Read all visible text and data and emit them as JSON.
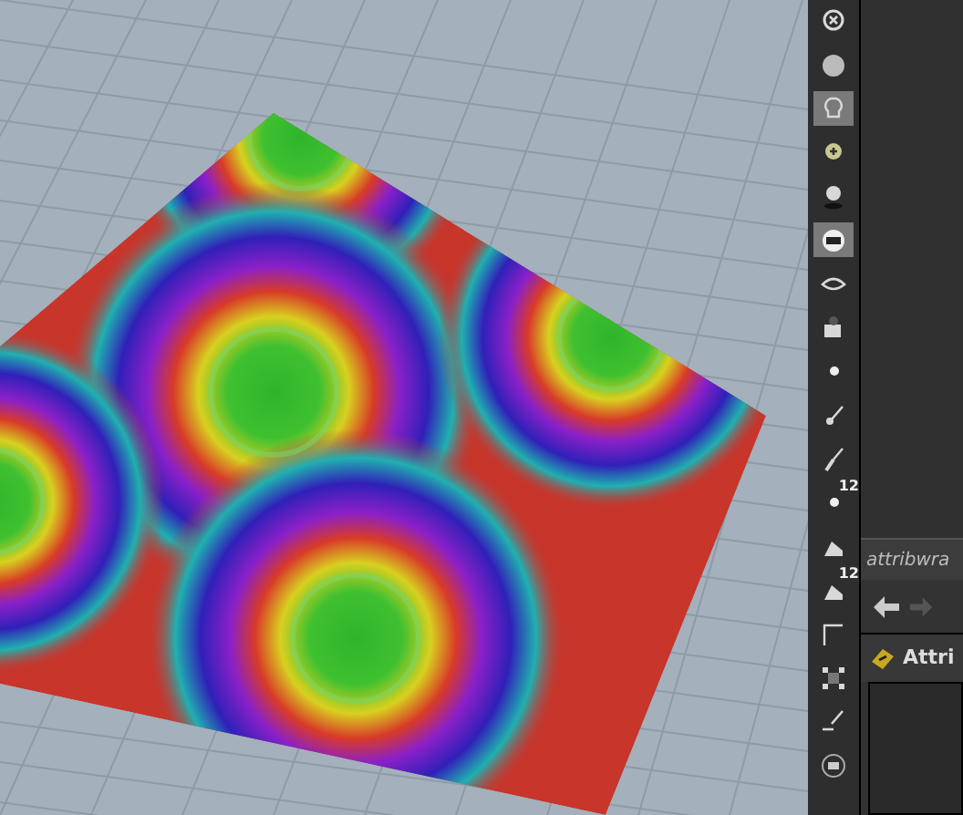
{
  "shelf": {
    "buttons": [
      {
        "selected": false
      },
      {
        "selected": false
      },
      {
        "selected": true
      },
      {
        "selected": false
      },
      {
        "selected": false
      },
      {
        "selected": true
      },
      {
        "selected": false
      },
      {
        "selected": false
      },
      {
        "selected": false
      },
      {
        "selected": false
      },
      {
        "selected": false
      },
      {
        "selected": false,
        "label": "12"
      },
      {
        "selected": false
      },
      {
        "selected": false,
        "label": "12"
      },
      {
        "selected": false
      },
      {
        "selected": false
      },
      {
        "selected": false
      },
      {
        "selected": false
      }
    ]
  },
  "panel": {
    "tab": "attribwra",
    "node_title": "Attri"
  }
}
